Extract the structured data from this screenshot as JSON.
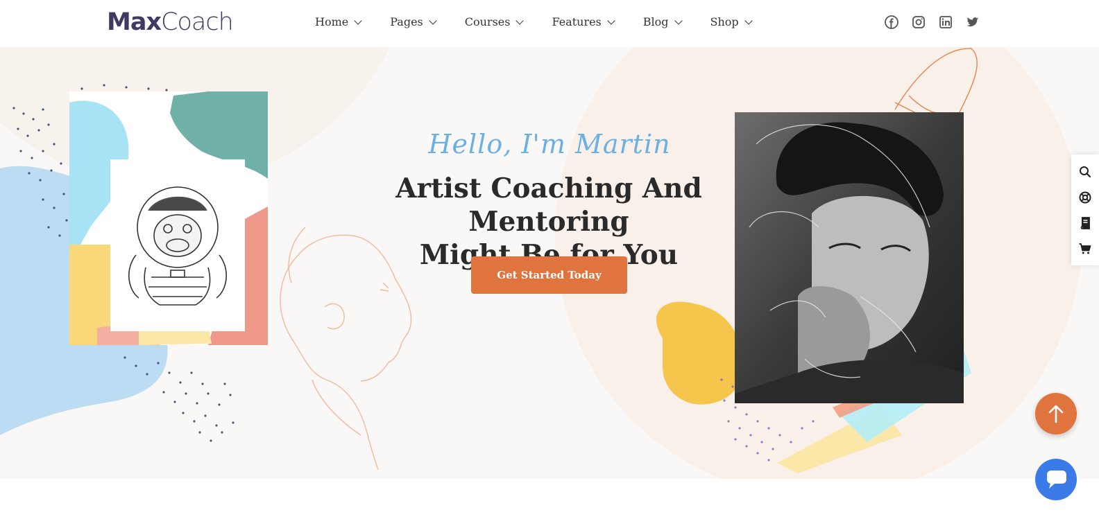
{
  "header": {
    "logo": {
      "part1": "Max",
      "part2": "Coach"
    },
    "nav": [
      {
        "label": "Home"
      },
      {
        "label": "Pages"
      },
      {
        "label": "Courses"
      },
      {
        "label": "Features"
      },
      {
        "label": "Blog"
      },
      {
        "label": "Shop"
      }
    ],
    "social_icons": [
      "facebook-icon",
      "instagram-icon",
      "linkedin-icon",
      "twitter-icon"
    ]
  },
  "hero": {
    "script_line": "Hello, I'm Martin",
    "title_line1": "Artist Coaching And Mentoring",
    "title_line2": "Might Be for You",
    "cta_label": "Get Started Today"
  },
  "side_toolbar": {
    "icons": [
      "search-icon",
      "lifebuoy-icon",
      "book-icon",
      "cart-icon"
    ]
  },
  "floating": {
    "to_top_icon": "arrow-up-icon",
    "chat_icon": "chat-icon"
  },
  "colors": {
    "brand": "#3f3a64",
    "accent": "#e0743f",
    "script": "#6bb0e4",
    "hero_bg": "#faf8f6",
    "chat": "#3a7be8"
  }
}
